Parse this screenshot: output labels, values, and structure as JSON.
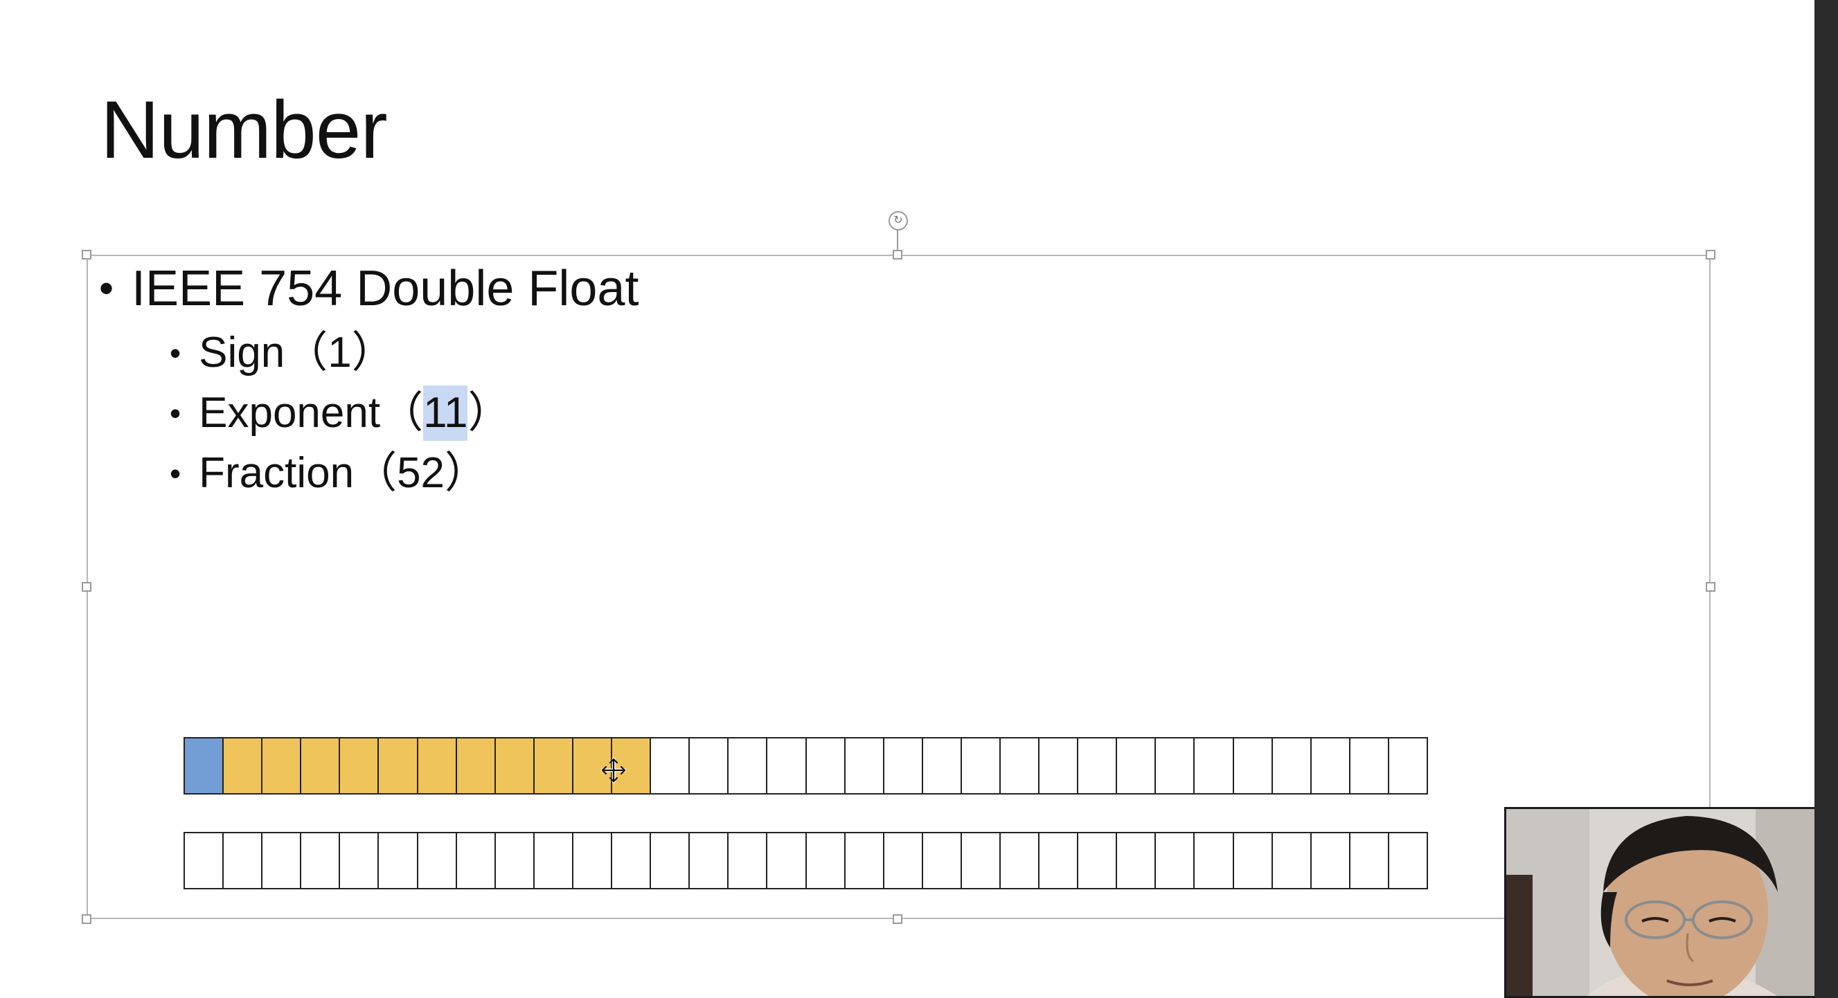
{
  "slide": {
    "title": "Number",
    "bullets": {
      "main": "IEEE 754 Double Float",
      "sign": "Sign（1）",
      "exponent_prefix": "Exponent（",
      "exponent_value": "11",
      "exponent_suffix": "）",
      "fraction": "Fraction（52）"
    },
    "bullet_char": "•",
    "rotate_glyph": "↻"
  },
  "bit_diagram": {
    "cells_per_row": 32,
    "rows": [
      {
        "sign_bits": 1,
        "exponent_bits": 11
      },
      {
        "sign_bits": 0,
        "exponent_bits": 0
      }
    ],
    "colors": {
      "sign": "#739ed5",
      "exponent": "#efc45b",
      "fraction": "#ffffff"
    }
  },
  "cursor": {
    "icon": "move-cursor-icon"
  },
  "webcam": {
    "icon": "presenter-webcam"
  }
}
